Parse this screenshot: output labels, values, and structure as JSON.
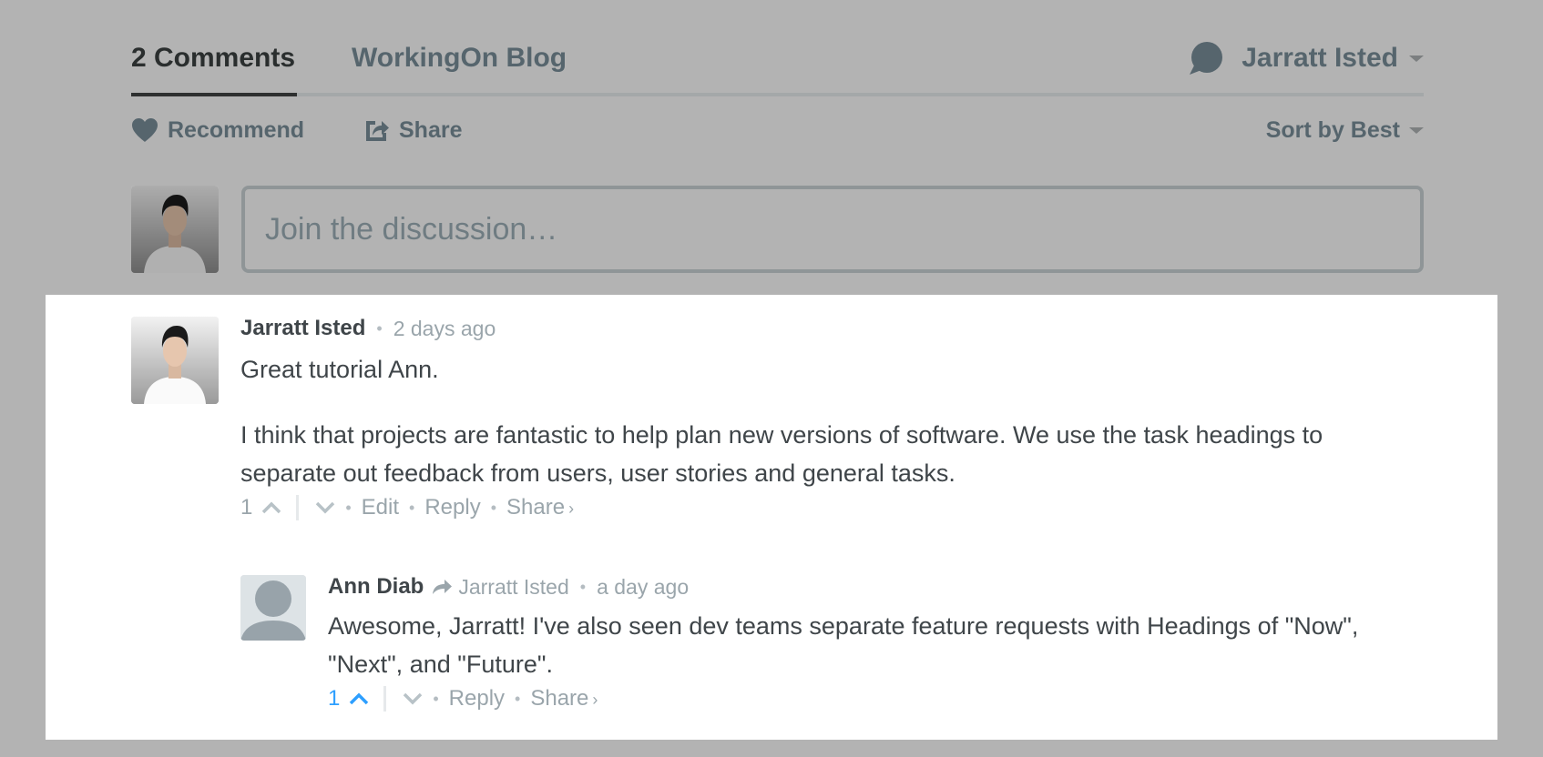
{
  "header": {
    "tabs": [
      {
        "label": "2 Comments",
        "active": true
      },
      {
        "label": "WorkingOn Blog",
        "active": false
      }
    ],
    "user_menu": {
      "name": "Jarratt Isted",
      "icon": "chat-bubble-icon"
    }
  },
  "toolbar": {
    "recommend_label": "Recommend",
    "recommend_icon": "heart-icon",
    "share_label": "Share",
    "share_icon": "share-icon",
    "sort_label": "Sort by Best"
  },
  "composer": {
    "placeholder": "Join the discussion…"
  },
  "comments": [
    {
      "author": "Jarratt Isted",
      "time": "2 days ago",
      "paragraphs": [
        "Great tutorial Ann.",
        "I think that projects are fantastic to help plan new versions of software. We use the task headings to separate out feedback from users, user stories and general tasks."
      ],
      "votes": "1",
      "upvoted": false,
      "actions": {
        "edit": "Edit",
        "reply": "Reply",
        "share": "Share"
      },
      "replies": [
        {
          "author": "Ann Diab",
          "in_reply_to": "Jarratt Isted",
          "time": "a day ago",
          "message": "Awesome, Jarratt! I've also seen dev teams separate feature requests with Headings of \"Now\", \"Next\", and \"Future\".",
          "votes": "1",
          "upvoted": true,
          "actions": {
            "reply": "Reply",
            "share": "Share"
          }
        }
      ]
    }
  ],
  "colors": {
    "overlay": "#b3b3b3",
    "upvote_active": "#2e9fff",
    "muted_text": "#9aa5ab",
    "body_text": "#3f4549"
  }
}
